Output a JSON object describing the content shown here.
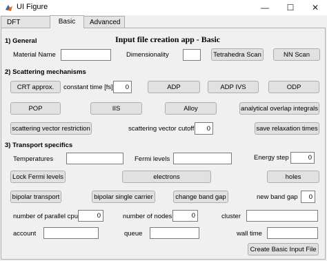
{
  "window": {
    "title": "UI Figure",
    "minimize": "—",
    "maximize": "☐",
    "close": "✕"
  },
  "tabs": [
    "DFT interface",
    "Basic",
    "Advanced"
  ],
  "app_title": "Input file creation app - Basic",
  "general": {
    "heading": "1) General",
    "material_name_label": "Material Name",
    "material_name_value": "",
    "dimensionality_label": "Dimensionality",
    "dimensionality_value": "",
    "tetrahedra_scan": "Tetrahedra Scan",
    "nn_scan": "NN Scan"
  },
  "scattering": {
    "heading": "2) Scattering mechanisms",
    "crt_approx": "CRT approx.",
    "constant_time_label": "constant time [fs]",
    "constant_time_value": "0",
    "adp": "ADP",
    "adp_ivs": "ADP IVS",
    "odp": "ODP",
    "pop": "POP",
    "iis": "IIS",
    "alloy": "Alloy",
    "analytical_overlap": "analytical overlap integrals",
    "scattering_vector_restriction": "scattering vector restriction",
    "scattering_vector_cutoff_label": "scattering vector cutoff",
    "scattering_vector_cutoff_value": "0",
    "save_relaxation_times": "save relaxation times"
  },
  "transport": {
    "heading": "3) Transport specifics",
    "temperatures_label": "Temperatures",
    "temperatures_value": "",
    "fermi_levels_label": "Fermi levels",
    "fermi_levels_value": "",
    "energy_step_label": "Energy step",
    "energy_step_value": "0",
    "lock_fermi_levels": "Lock Fermi levels",
    "electrons": "electrons",
    "holes": "holes",
    "bipolar_transport": "bipolar transport",
    "bipolar_single_carrier": "bipolar single carrier",
    "change_band_gap": "change band gap",
    "new_band_gap_label": "new band gap",
    "new_band_gap_value": "0",
    "parallel_cpu_label": "number of parallel cpu",
    "parallel_cpu_value": "0",
    "nodes_label": "number of nodes",
    "nodes_value": "0",
    "cluster_label": "cluster",
    "cluster_value": "",
    "account_label": "account",
    "account_value": "",
    "queue_label": "queue",
    "queue_value": "",
    "wall_time_label": "wall time",
    "wall_time_value": "",
    "create_basic_input": "Create Basic Input File"
  }
}
